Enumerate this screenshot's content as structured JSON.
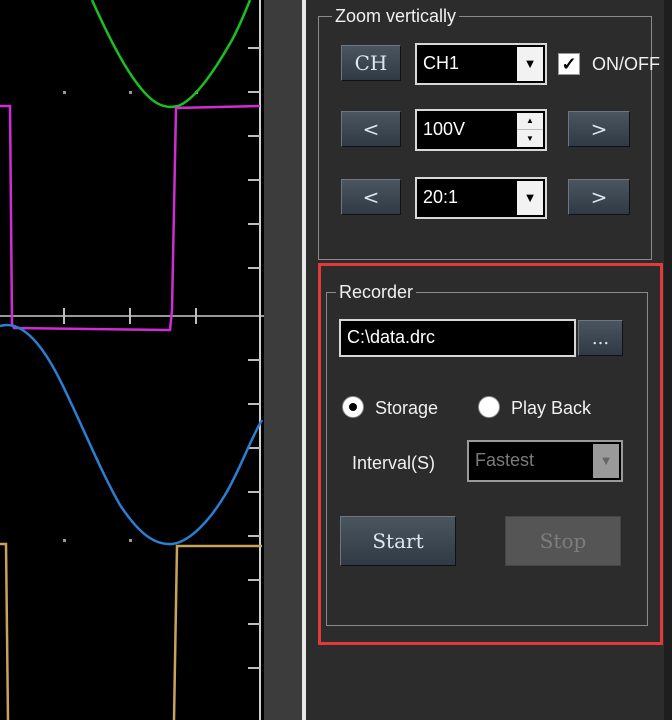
{
  "zoom": {
    "title": "Zoom vertically",
    "ch_button": "CH",
    "channel_select": "CH1",
    "onoff_label": "ON/OFF",
    "onoff_checked": true,
    "voltage_value": "100V",
    "ratio_select": "20:1",
    "prev_glyph": "<",
    "next_glyph": ">"
  },
  "recorder": {
    "title": "Recorder",
    "file_path": "C:\\data.drc",
    "browse_label": "...",
    "storage_label": "Storage",
    "playback_label": "Play Back",
    "selected_mode": "Storage",
    "interval_label": "Interval(S)",
    "interval_select": "Fastest",
    "start_label": "Start",
    "stop_label": "Stop"
  },
  "colors": {
    "trace_green": "#19c11f",
    "trace_magenta": "#d12cd3",
    "trace_blue": "#2b7fd3",
    "trace_tan": "#c9a25b",
    "highlight": "#e23a3a"
  },
  "icons": {
    "dropdown": "chevron-down-icon",
    "spin": "spin-arrows-icon",
    "check": "check-icon"
  }
}
